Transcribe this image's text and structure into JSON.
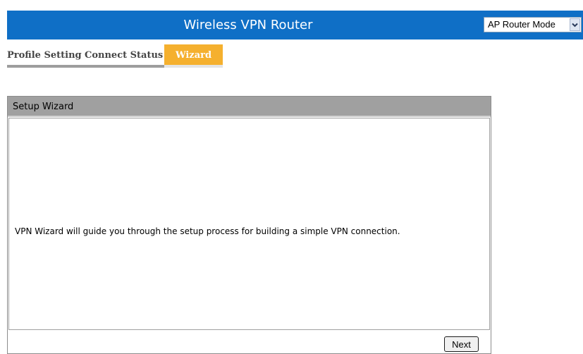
{
  "header": {
    "title": "Wireless VPN Router",
    "mode_select": {
      "selected": "AP Router Mode",
      "dropdown_icon": "chevron-down-icon"
    }
  },
  "tabs": [
    {
      "label": "Profile Setting",
      "active": false
    },
    {
      "label": "Connect Status",
      "active": false
    },
    {
      "label": "Wizard",
      "active": true
    }
  ],
  "wizard": {
    "title": "Setup Wizard",
    "message": "VPN Wizard will guide you through the setup process for building a simple VPN connection.",
    "next_label": "Next"
  },
  "colors": {
    "header_bg": "#0f6fc6",
    "active_tab_bg": "#f5b02e",
    "panel_header_bg": "#a0a0a0"
  }
}
